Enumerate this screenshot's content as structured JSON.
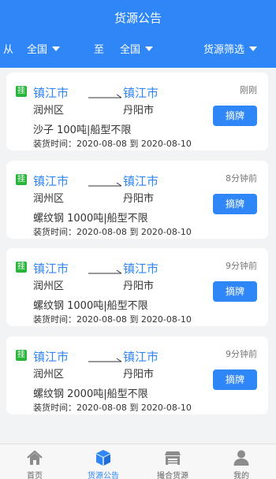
{
  "header": {
    "title": "货源公告",
    "filters": {
      "from_label": "从",
      "from_value": "全国",
      "to_label": "至",
      "to_value": "全国",
      "filter_label": "货源筛选"
    }
  },
  "cards": [
    {
      "tag": "挂",
      "from_city": "镇江市",
      "to_city": "镇江市",
      "from_district": "润州区",
      "to_district": "丹阳市",
      "cargo": "沙子 100吨|船型不限",
      "load_time": "装货时间：2020-08-08 到 2020-08-10",
      "time_ago": "刚刚",
      "button": "摘牌"
    },
    {
      "tag": "挂",
      "from_city": "镇江市",
      "to_city": "镇江市",
      "from_district": "润州区",
      "to_district": "丹阳市",
      "cargo": "螺纹钢 1000吨|船型不限",
      "load_time": "装货时间：2020-08-08 到 2020-08-10",
      "time_ago": "8分钟前",
      "button": "摘牌"
    },
    {
      "tag": "挂",
      "from_city": "镇江市",
      "to_city": "镇江市",
      "from_district": "润州区",
      "to_district": "丹阳市",
      "cargo": "螺纹钢 1000吨|船型不限",
      "load_time": "装货时间：2020-08-08 到 2020-08-10",
      "time_ago": "9分钟前",
      "button": "摘牌"
    },
    {
      "tag": "挂",
      "from_city": "镇江市",
      "to_city": "镇江市",
      "from_district": "润州区",
      "to_district": "丹阳市",
      "cargo": "螺纹钢 2000吨|船型不限",
      "load_time": "装货时间：2020-08-08 到 2020-08-10",
      "time_ago": "9分钟前",
      "button": "摘牌"
    }
  ],
  "tabbar": {
    "items": [
      {
        "label": "首页",
        "icon": "home-icon"
      },
      {
        "label": "货源公告",
        "icon": "package-icon"
      },
      {
        "label": "撮合货源",
        "icon": "store-icon"
      },
      {
        "label": "我的",
        "icon": "user-icon"
      }
    ]
  },
  "colors": {
    "primary": "#2f86f6",
    "tag_green": "#28b63a"
  }
}
